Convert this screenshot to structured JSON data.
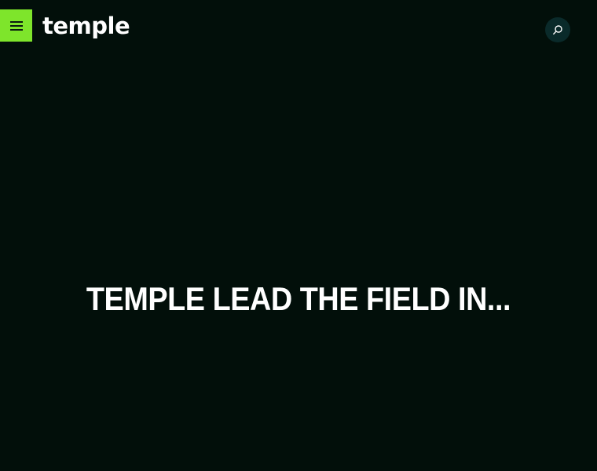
{
  "header": {
    "logo_text": "temple",
    "menu_icon": "hamburger-menu-icon",
    "search_icon": "search-icon",
    "menu_button_color": "#7ee52b",
    "search_button_color": "#0a2a2a"
  },
  "hero": {
    "heading": "TEMPLE LEAD THE FIELD IN..."
  },
  "colors": {
    "background": "#020f0a",
    "accent": "#7ee52b",
    "text": "#ffffff"
  }
}
